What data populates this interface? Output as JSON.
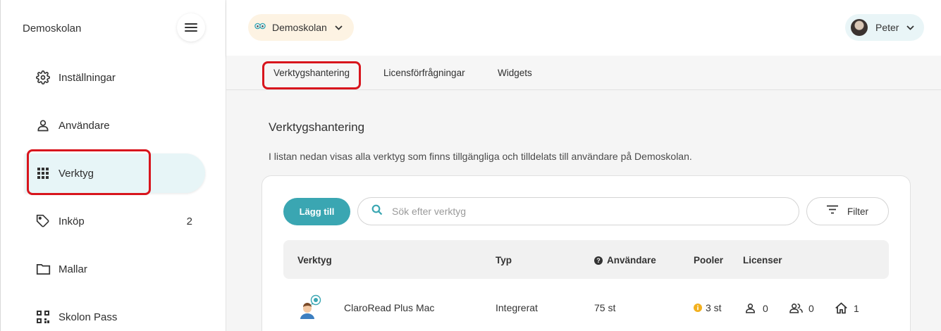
{
  "sidebar": {
    "title": "Demoskolan",
    "items": [
      {
        "label": "Inställningar",
        "icon": "gear-icon",
        "count": ""
      },
      {
        "label": "Användare",
        "icon": "user-icon",
        "count": ""
      },
      {
        "label": "Verktyg",
        "icon": "grid-icon",
        "count": "",
        "active": true
      },
      {
        "label": "Inköp",
        "icon": "tag-icon",
        "count": "2"
      },
      {
        "label": "Mallar",
        "icon": "folder-icon",
        "count": ""
      },
      {
        "label": "Skolon Pass",
        "icon": "qr-icon",
        "count": ""
      }
    ]
  },
  "topbar": {
    "school": "Demoskolan",
    "user": "Peter"
  },
  "tabs": [
    "Verktygshantering",
    "Licensförfrågningar",
    "Widgets"
  ],
  "main": {
    "title": "Verktygshantering",
    "description": "I listan nedan visas alla verktyg som finns tillgängliga och tilldelats till användare på Demoskolan.",
    "add_label": "Lägg till",
    "search_placeholder": "Sök efter verktyg",
    "filter_label": "Filter",
    "columns": {
      "tool": "Verktyg",
      "type": "Typ",
      "users": "Användare",
      "pools": "Pooler",
      "licenses": "Licenser"
    },
    "rows": [
      {
        "name": "ClaroRead Plus Mac",
        "type": "Integrerat",
        "users": "75 st",
        "pools": "3 st",
        "lic_user": "0",
        "lic_group": "0",
        "lic_school": "1"
      }
    ]
  },
  "colors": {
    "accent": "#3aa6b2",
    "active_nav_bg": "#e7f5f7",
    "highlight": "#d8151d",
    "pool_info": "#f2b01e"
  }
}
